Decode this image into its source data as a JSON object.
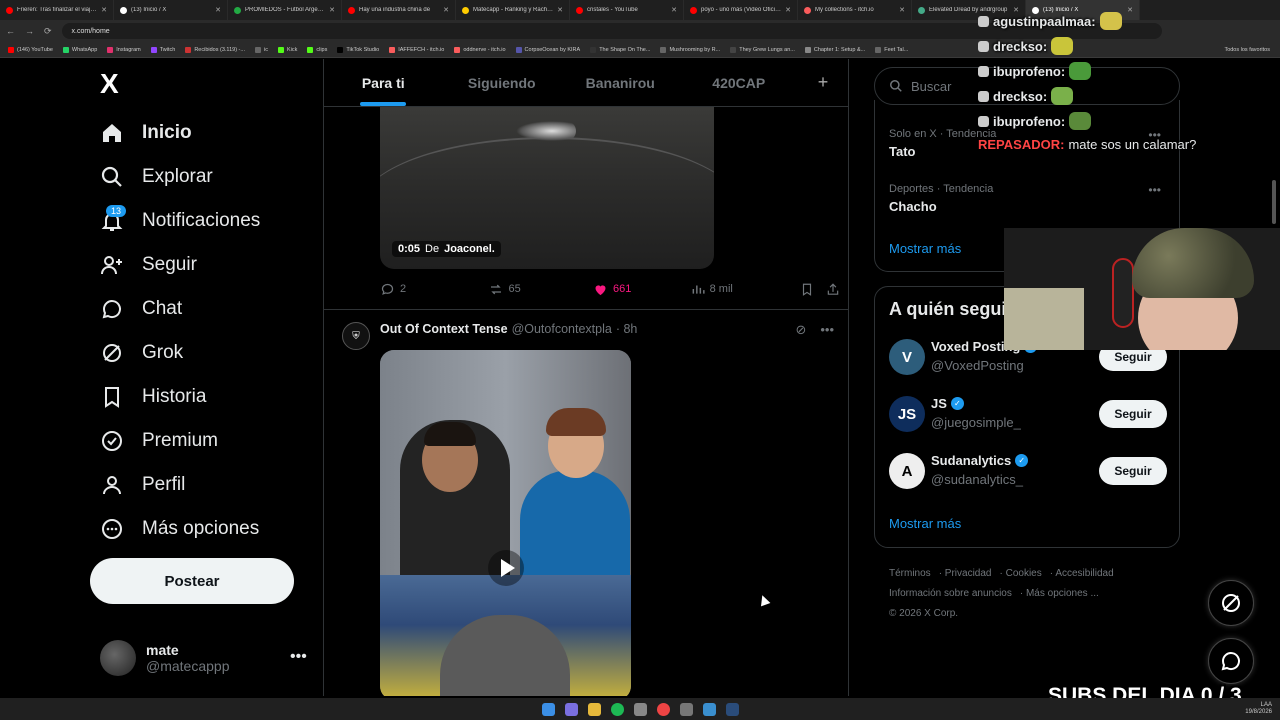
{
  "browser": {
    "tabs": [
      {
        "title": "Frieren: Tras finalizar el viaje -",
        "color": "#ff0000"
      },
      {
        "title": "(13) Inicio / X",
        "color": "#ffffff"
      },
      {
        "title": "PROMIEDOS - Futbol Argentino",
        "color": "#22aa44"
      },
      {
        "title": "Hay una industria china de",
        "color": "#ff0000"
      },
      {
        "title": "Matecapp - Ranking y Rachas",
        "color": "#ffcc00"
      },
      {
        "title": "cristales - YouTube",
        "color": "#ff0000"
      },
      {
        "title": "poyo - uno más (Video Oficial)",
        "color": "#ff0000"
      },
      {
        "title": "My collections - itch.io",
        "color": "#fa5c5c"
      },
      {
        "title": "Elevated Dread by andrgroup",
        "color": "#44aa88"
      },
      {
        "title": "(13) Inicio / X",
        "color": "#ffffff"
      }
    ],
    "url": "x.com/home",
    "bookmarks": [
      "(146) YouTube",
      "WhatsApp",
      "Instagram",
      "Twitch",
      "Recibidos (3.119) -...",
      "ic",
      "Kick",
      "clips",
      "TikTok Studio",
      "IAFFEFCH - itch.io",
      "oddnerve - itch.io",
      "CorpseOcean by KIRA",
      "The Shape On The...",
      "Mushrooming by R...",
      "They Grew Lungs an...",
      "Chapter 1: Setup &...",
      "Feet Tal..."
    ],
    "bookmarks_all": "Todos los favoritos"
  },
  "nav": {
    "logo": "X",
    "items": [
      {
        "label": "Inicio",
        "icon": "home-icon"
      },
      {
        "label": "Explorar",
        "icon": "search-icon"
      },
      {
        "label": "Notificaciones",
        "icon": "bell-icon"
      },
      {
        "label": "Seguir",
        "icon": "person-plus-icon"
      },
      {
        "label": "Chat",
        "icon": "chat-bubble-icon"
      },
      {
        "label": "Grok",
        "icon": "grok-icon"
      },
      {
        "label": "Historia",
        "icon": "bookmark-icon"
      },
      {
        "label": "Premium",
        "icon": "verified-badge-icon"
      },
      {
        "label": "Perfil",
        "icon": "person-icon"
      },
      {
        "label": "Más opciones",
        "icon": "more-circle-icon"
      }
    ],
    "notif_count": "13",
    "post_label": "Postear",
    "user": {
      "name": "mate",
      "handle": "@matecappp"
    }
  },
  "feed": {
    "tabs": [
      "Para ti",
      "Siguiendo",
      "Bananirou",
      "420CAP"
    ],
    "add_tab": "+",
    "tweet1": {
      "video_time": "0:05",
      "video_from": "De",
      "video_author": "Joaconel.",
      "replies": "2",
      "retweets": "65",
      "likes": "661",
      "views": "8 mil"
    },
    "tweet2": {
      "name": "Out Of Context Tense",
      "handle": "@Outofcontextpla",
      "time": "· 8h"
    }
  },
  "sidebar": {
    "search_placeholder": "Buscar",
    "trends": [
      {
        "category": "Solo en X · Tendencia",
        "title": "Tato"
      },
      {
        "category": "Deportes · Tendencia",
        "title": "Chacho"
      }
    ],
    "show_more": "Mostrar más",
    "follow_title": "A quién seguir",
    "follow": [
      {
        "name": "Voxed Posting",
        "handle": "@VoxedPosting",
        "initial": "V",
        "bg": "#2d5d7b",
        "fg": "#ffffff"
      },
      {
        "name": "JS",
        "handle": "@juegosimple_",
        "initial": "JS",
        "bg": "#0e2d5c",
        "fg": "#ffffff"
      },
      {
        "name": "Sudanalytics",
        "handle": "@sudanalytics_",
        "initial": "A",
        "bg": "#eeeeee",
        "fg": "#000000"
      }
    ],
    "follow_button": "Seguir",
    "footer": [
      "Términos",
      "Privacidad",
      "Cookies",
      "Accesibilidad",
      "Información sobre anuncios",
      "Más opciones ...",
      "© 2026 X Corp."
    ]
  },
  "stream": {
    "chat": [
      {
        "user": "agustinpaalmaa:",
        "text": "",
        "color": "#e7e9ea",
        "emote": "#d4c24a"
      },
      {
        "user": "drecks​o:",
        "text": "",
        "color": "#e7e9ea",
        "emote": "#c9c53a"
      },
      {
        "user": "ibuprofeno:",
        "text": "",
        "color": "#e7e9ea",
        "emote": "#4a9a3a"
      },
      {
        "user": "drecks​o:",
        "text": "",
        "color": "#e7e9ea",
        "emote": "#7ab04a"
      },
      {
        "user": "ibuprofeno:",
        "text": "",
        "color": "#e7e9ea",
        "emote": "#5a8a3a"
      },
      {
        "user": "REPASADOR:",
        "text": "mate sos un calamar?",
        "color": "#ff4444",
        "emote": ""
      }
    ],
    "subs_text": "SUBS DEL DIA 0 / 3"
  },
  "taskbar": {
    "lang": "LAA",
    "date": "19/8/2026"
  }
}
